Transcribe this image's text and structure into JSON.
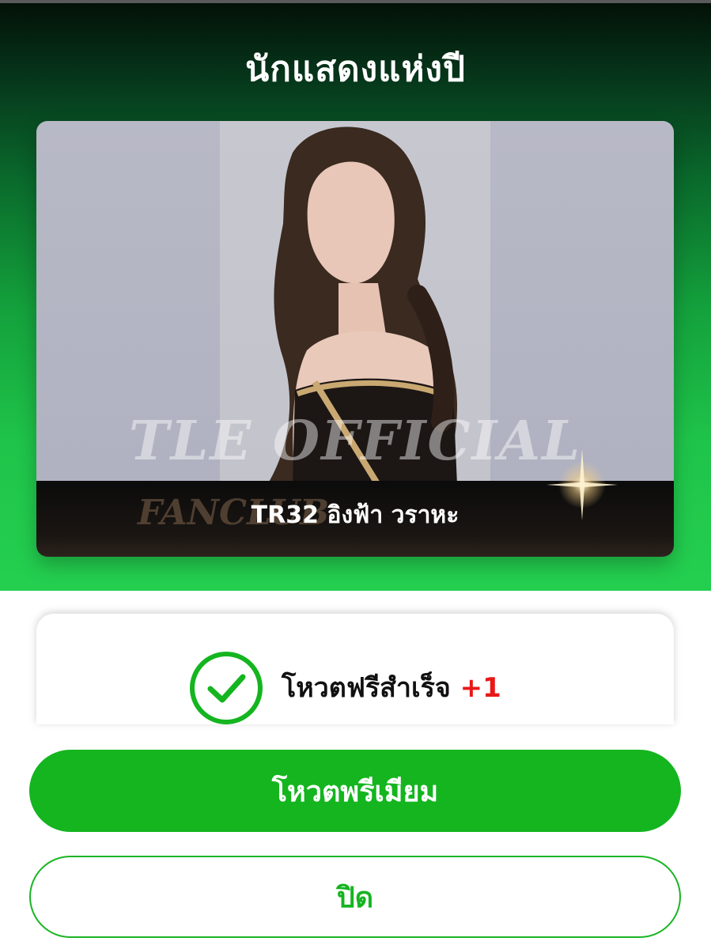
{
  "header": {
    "title": "นักแสดงแห่งปี"
  },
  "candidate": {
    "name": "TR32 อิงฟ้า วราหะ",
    "watermark_main": "TLE OFFICIAL",
    "watermark_sub": "FANCLUB"
  },
  "vote_status": {
    "message": "โหวตฟรีสำเร็จ",
    "increment": "+1"
  },
  "actions": {
    "premium_label": "โหวตพรีเมียม",
    "close_label": "ปิด"
  },
  "colors": {
    "accent_green": "#14b51f",
    "increment_red": "#e81818"
  },
  "icons": {
    "success": "check-circle-icon"
  }
}
